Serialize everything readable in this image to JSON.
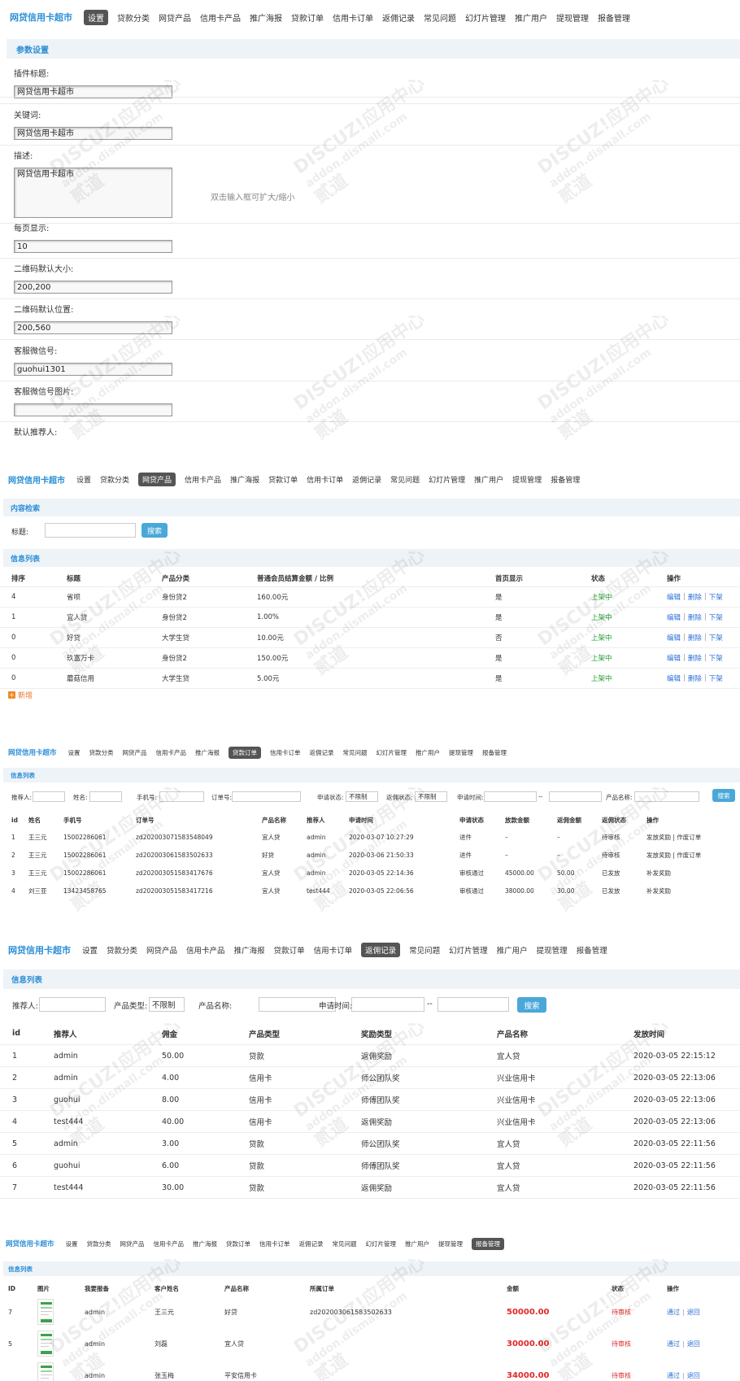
{
  "brand": "网贷信用卡超市",
  "nav_items": [
    "设置",
    "贷款分类",
    "网贷产品",
    "信用卡产品",
    "推广海报",
    "贷款订单",
    "信用卡订单",
    "返佣记录",
    "常见问题",
    "幻灯片管理",
    "推广用户",
    "提现管理",
    "报备管理"
  ],
  "settings": {
    "section_title": "参数设置",
    "fields": [
      {
        "label": "插件标题:",
        "value": "网贷信用卡超市"
      },
      {
        "label": "关键词:",
        "value": "网贷信用卡超市"
      },
      {
        "label": "描述:",
        "value": "网贷信用卡超市",
        "hint": "双击输入框可扩大/缩小"
      },
      {
        "label": "每页显示:",
        "value": "10"
      },
      {
        "label": "二维码默认大小:",
        "value": "200,200"
      },
      {
        "label": "二维码默认位置:",
        "value": "200,560"
      },
      {
        "label": "客服微信号:",
        "value": "guohui1301"
      },
      {
        "label": "客服微信号图片:",
        "value": ""
      },
      {
        "label": "默认推荐人:",
        "value": ""
      }
    ]
  },
  "products": {
    "search_title": "内容检索",
    "title_label": "标题:",
    "search_btn": "搜索",
    "list_title": "信息列表",
    "headers": [
      "排序",
      "标题",
      "产品分类",
      "普通会员结算金额 / 比例",
      "首页显示",
      "状态",
      "操作"
    ],
    "rows": [
      [
        "4",
        "省呗",
        "身份贷2",
        "160.00元",
        "是",
        "上架中"
      ],
      [
        "1",
        "宜人贷",
        "身份贷2",
        "1.00%",
        "是",
        "上架中"
      ],
      [
        "0",
        "好贷",
        "大学生贷",
        "10.00元",
        "否",
        "上架中"
      ],
      [
        "0",
        "玖富万卡",
        "身份贷2",
        "150.00元",
        "是",
        "上架中"
      ],
      [
        "0",
        "蘑菇信用",
        "大学生贷",
        "5.00元",
        "是",
        "上架中"
      ]
    ],
    "actions": [
      "编辑",
      "删除",
      "下架"
    ],
    "add_label": "新增"
  },
  "orders": {
    "list_title": "信息列表",
    "filters": [
      "推荐人:",
      "姓名:",
      "手机号:",
      "订单号:",
      "申请状态:",
      "返佣状态:",
      "申请时间:",
      "产品名称:"
    ],
    "select_value": "不限制",
    "dash": "--",
    "search_btn": "搜索",
    "headers": [
      "id",
      "姓名",
      "手机号",
      "订单号",
      "产品名称",
      "推荐人",
      "申请时间",
      "申请状态",
      "放款金额",
      "返佣金额",
      "返佣状态",
      "操作"
    ],
    "rows": [
      [
        "1",
        "王三元",
        "15002286061",
        "zd202003071583548049",
        "宜人贷",
        "admin",
        "2020-03-07 10:27:29",
        "进件",
        "–",
        "–",
        "待审核",
        "发放奖励 | 作废订单"
      ],
      [
        "2",
        "王三元",
        "15002286061",
        "zd202003061583502633",
        "好贷",
        "admin",
        "2020-03-06 21:50:33",
        "进件",
        "–",
        "–",
        "待审核",
        "发放奖励 | 作废订单"
      ],
      [
        "3",
        "王三元",
        "15002286061",
        "zd202003051583417676",
        "宜人贷",
        "admin",
        "2020-03-05 22:14:36",
        "审核通过",
        "45000.00",
        "50.00",
        "已发放",
        "补发奖励"
      ],
      [
        "4",
        "刘三亚",
        "13423458765",
        "zd202003051583417216",
        "宜人贷",
        "test444",
        "2020-03-05 22:06:56",
        "审核通过",
        "38000.00",
        "30.00",
        "已发放",
        "补发奖励"
      ]
    ]
  },
  "commissions": {
    "list_title": "信息列表",
    "filters": [
      "推荐人:",
      "产品类型:",
      "产品名称:",
      "申请时间:"
    ],
    "select_value": "不限制",
    "dash": "--",
    "search_btn": "搜索",
    "headers": [
      "id",
      "推荐人",
      "佣金",
      "产品类型",
      "奖励类型",
      "产品名称",
      "发放时间"
    ],
    "rows": [
      [
        "1",
        "admin",
        "50.00",
        "贷款",
        "返佣奖励",
        "宜人贷",
        "2020-03-05 22:15:12"
      ],
      [
        "2",
        "admin",
        "4.00",
        "信用卡",
        "师公团队奖",
        "兴业信用卡",
        "2020-03-05 22:13:06"
      ],
      [
        "3",
        "guohui",
        "8.00",
        "信用卡",
        "师傅团队奖",
        "兴业信用卡",
        "2020-03-05 22:13:06"
      ],
      [
        "4",
        "test444",
        "40.00",
        "信用卡",
        "返佣奖励",
        "兴业信用卡",
        "2020-03-05 22:13:06"
      ],
      [
        "5",
        "admin",
        "3.00",
        "贷款",
        "师公团队奖",
        "宜人贷",
        "2020-03-05 22:11:56"
      ],
      [
        "6",
        "guohui",
        "6.00",
        "贷款",
        "师傅团队奖",
        "宜人贷",
        "2020-03-05 22:11:56"
      ],
      [
        "7",
        "test444",
        "30.00",
        "贷款",
        "返佣奖励",
        "宜人贷",
        "2020-03-05 22:11:56"
      ]
    ]
  },
  "reports": {
    "list_title": "信息列表",
    "headers": [
      "ID",
      "图片",
      "我要报备",
      "客户姓名",
      "产品名称",
      "所属订单",
      "金额",
      "状态",
      "操作"
    ],
    "rows": [
      [
        "7",
        "admin",
        "王三元",
        "好贷",
        "zd202003061583502633",
        "50000.00",
        "待审核"
      ],
      [
        "5",
        "admin",
        "刘磊",
        "宜人贷",
        "",
        "30000.00",
        "待审核"
      ],
      [
        "",
        "admin",
        "张玉梅",
        "平安信用卡",
        "",
        "34000.00",
        "待审核"
      ]
    ],
    "actions": [
      "通过",
      "退回"
    ]
  },
  "watermark": [
    "DISCUZ!应用中心",
    "addon.dismall.com",
    "贰道"
  ],
  "colors": {
    "accent": "#2b8fd6",
    "section_bg": "#eef3f8",
    "green": "#1e9b2a",
    "red": "#e0282a",
    "button": "#4aa8d8"
  }
}
